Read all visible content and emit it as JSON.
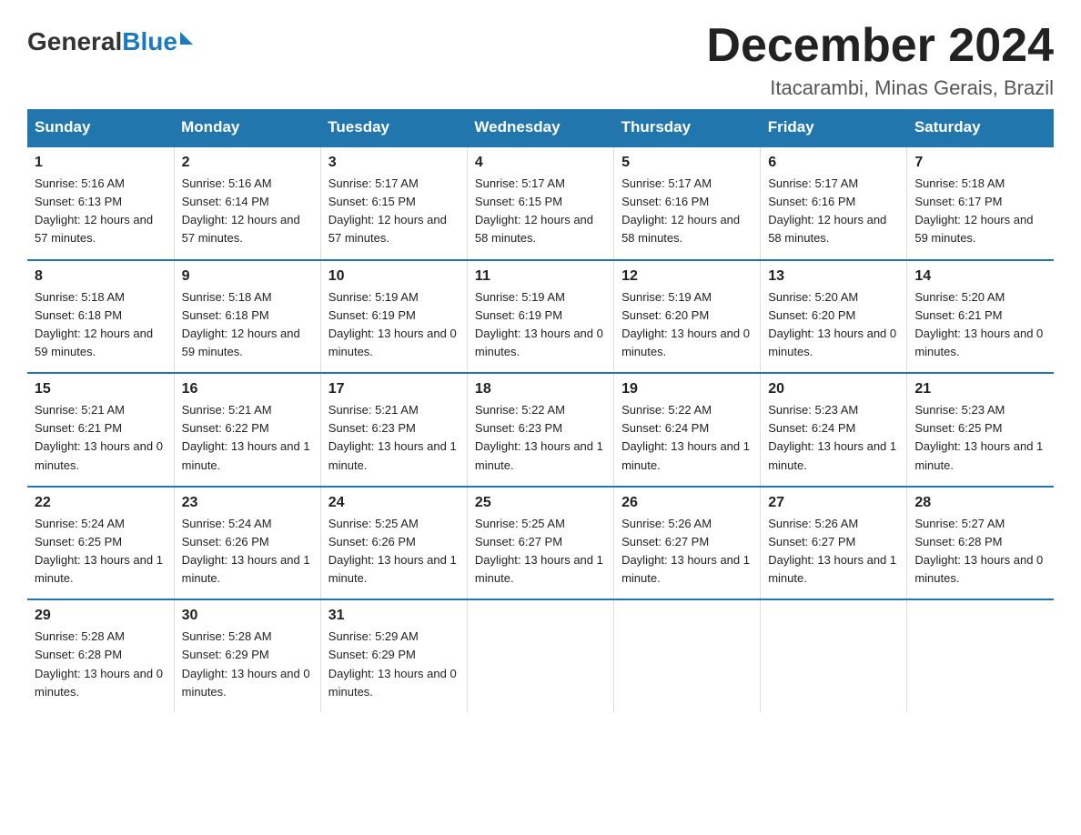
{
  "header": {
    "logo_general": "General",
    "logo_blue": "Blue",
    "title": "December 2024",
    "location": "Itacarambi, Minas Gerais, Brazil"
  },
  "days_of_week": [
    "Sunday",
    "Monday",
    "Tuesday",
    "Wednesday",
    "Thursday",
    "Friday",
    "Saturday"
  ],
  "weeks": [
    [
      {
        "day": "1",
        "sunrise": "5:16 AM",
        "sunset": "6:13 PM",
        "daylight": "12 hours and 57 minutes."
      },
      {
        "day": "2",
        "sunrise": "5:16 AM",
        "sunset": "6:14 PM",
        "daylight": "12 hours and 57 minutes."
      },
      {
        "day": "3",
        "sunrise": "5:17 AM",
        "sunset": "6:15 PM",
        "daylight": "12 hours and 57 minutes."
      },
      {
        "day": "4",
        "sunrise": "5:17 AM",
        "sunset": "6:15 PM",
        "daylight": "12 hours and 58 minutes."
      },
      {
        "day": "5",
        "sunrise": "5:17 AM",
        "sunset": "6:16 PM",
        "daylight": "12 hours and 58 minutes."
      },
      {
        "day": "6",
        "sunrise": "5:17 AM",
        "sunset": "6:16 PM",
        "daylight": "12 hours and 58 minutes."
      },
      {
        "day": "7",
        "sunrise": "5:18 AM",
        "sunset": "6:17 PM",
        "daylight": "12 hours and 59 minutes."
      }
    ],
    [
      {
        "day": "8",
        "sunrise": "5:18 AM",
        "sunset": "6:18 PM",
        "daylight": "12 hours and 59 minutes."
      },
      {
        "day": "9",
        "sunrise": "5:18 AM",
        "sunset": "6:18 PM",
        "daylight": "12 hours and 59 minutes."
      },
      {
        "day": "10",
        "sunrise": "5:19 AM",
        "sunset": "6:19 PM",
        "daylight": "13 hours and 0 minutes."
      },
      {
        "day": "11",
        "sunrise": "5:19 AM",
        "sunset": "6:19 PM",
        "daylight": "13 hours and 0 minutes."
      },
      {
        "day": "12",
        "sunrise": "5:19 AM",
        "sunset": "6:20 PM",
        "daylight": "13 hours and 0 minutes."
      },
      {
        "day": "13",
        "sunrise": "5:20 AM",
        "sunset": "6:20 PM",
        "daylight": "13 hours and 0 minutes."
      },
      {
        "day": "14",
        "sunrise": "5:20 AM",
        "sunset": "6:21 PM",
        "daylight": "13 hours and 0 minutes."
      }
    ],
    [
      {
        "day": "15",
        "sunrise": "5:21 AM",
        "sunset": "6:21 PM",
        "daylight": "13 hours and 0 minutes."
      },
      {
        "day": "16",
        "sunrise": "5:21 AM",
        "sunset": "6:22 PM",
        "daylight": "13 hours and 1 minute."
      },
      {
        "day": "17",
        "sunrise": "5:21 AM",
        "sunset": "6:23 PM",
        "daylight": "13 hours and 1 minute."
      },
      {
        "day": "18",
        "sunrise": "5:22 AM",
        "sunset": "6:23 PM",
        "daylight": "13 hours and 1 minute."
      },
      {
        "day": "19",
        "sunrise": "5:22 AM",
        "sunset": "6:24 PM",
        "daylight": "13 hours and 1 minute."
      },
      {
        "day": "20",
        "sunrise": "5:23 AM",
        "sunset": "6:24 PM",
        "daylight": "13 hours and 1 minute."
      },
      {
        "day": "21",
        "sunrise": "5:23 AM",
        "sunset": "6:25 PM",
        "daylight": "13 hours and 1 minute."
      }
    ],
    [
      {
        "day": "22",
        "sunrise": "5:24 AM",
        "sunset": "6:25 PM",
        "daylight": "13 hours and 1 minute."
      },
      {
        "day": "23",
        "sunrise": "5:24 AM",
        "sunset": "6:26 PM",
        "daylight": "13 hours and 1 minute."
      },
      {
        "day": "24",
        "sunrise": "5:25 AM",
        "sunset": "6:26 PM",
        "daylight": "13 hours and 1 minute."
      },
      {
        "day": "25",
        "sunrise": "5:25 AM",
        "sunset": "6:27 PM",
        "daylight": "13 hours and 1 minute."
      },
      {
        "day": "26",
        "sunrise": "5:26 AM",
        "sunset": "6:27 PM",
        "daylight": "13 hours and 1 minute."
      },
      {
        "day": "27",
        "sunrise": "5:26 AM",
        "sunset": "6:27 PM",
        "daylight": "13 hours and 1 minute."
      },
      {
        "day": "28",
        "sunrise": "5:27 AM",
        "sunset": "6:28 PM",
        "daylight": "13 hours and 0 minutes."
      }
    ],
    [
      {
        "day": "29",
        "sunrise": "5:28 AM",
        "sunset": "6:28 PM",
        "daylight": "13 hours and 0 minutes."
      },
      {
        "day": "30",
        "sunrise": "5:28 AM",
        "sunset": "6:29 PM",
        "daylight": "13 hours and 0 minutes."
      },
      {
        "day": "31",
        "sunrise": "5:29 AM",
        "sunset": "6:29 PM",
        "daylight": "13 hours and 0 minutes."
      },
      null,
      null,
      null,
      null
    ]
  ],
  "labels": {
    "sunrise": "Sunrise:",
    "sunset": "Sunset:",
    "daylight": "Daylight:"
  }
}
